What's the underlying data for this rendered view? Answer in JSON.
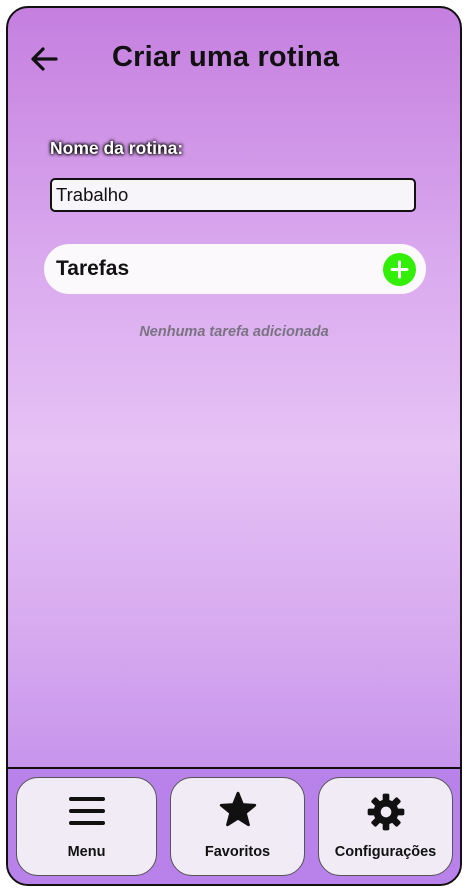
{
  "header": {
    "title": "Criar uma rotina",
    "back_icon": "arrow-left-icon"
  },
  "form": {
    "name_label": "Nome da rotina:",
    "name_value": "Trabalho"
  },
  "tasks": {
    "title": "Tarefas",
    "add_icon": "plus-circle-icon",
    "empty_message": "Nenhuma tarefa adicionada"
  },
  "nav": {
    "items": [
      {
        "label": "Menu",
        "icon": "hamburger-menu-icon"
      },
      {
        "label": "Favoritos",
        "icon": "star-icon"
      },
      {
        "label": "Configurações",
        "icon": "gear-icon"
      }
    ]
  },
  "colors": {
    "accent_green": "#33ee06",
    "gradient_top": "#c57fdf",
    "gradient_mid": "#e6c2f5",
    "gradient_bottom": "#b982ea",
    "nav_button_bg": "#f1ebf6"
  }
}
